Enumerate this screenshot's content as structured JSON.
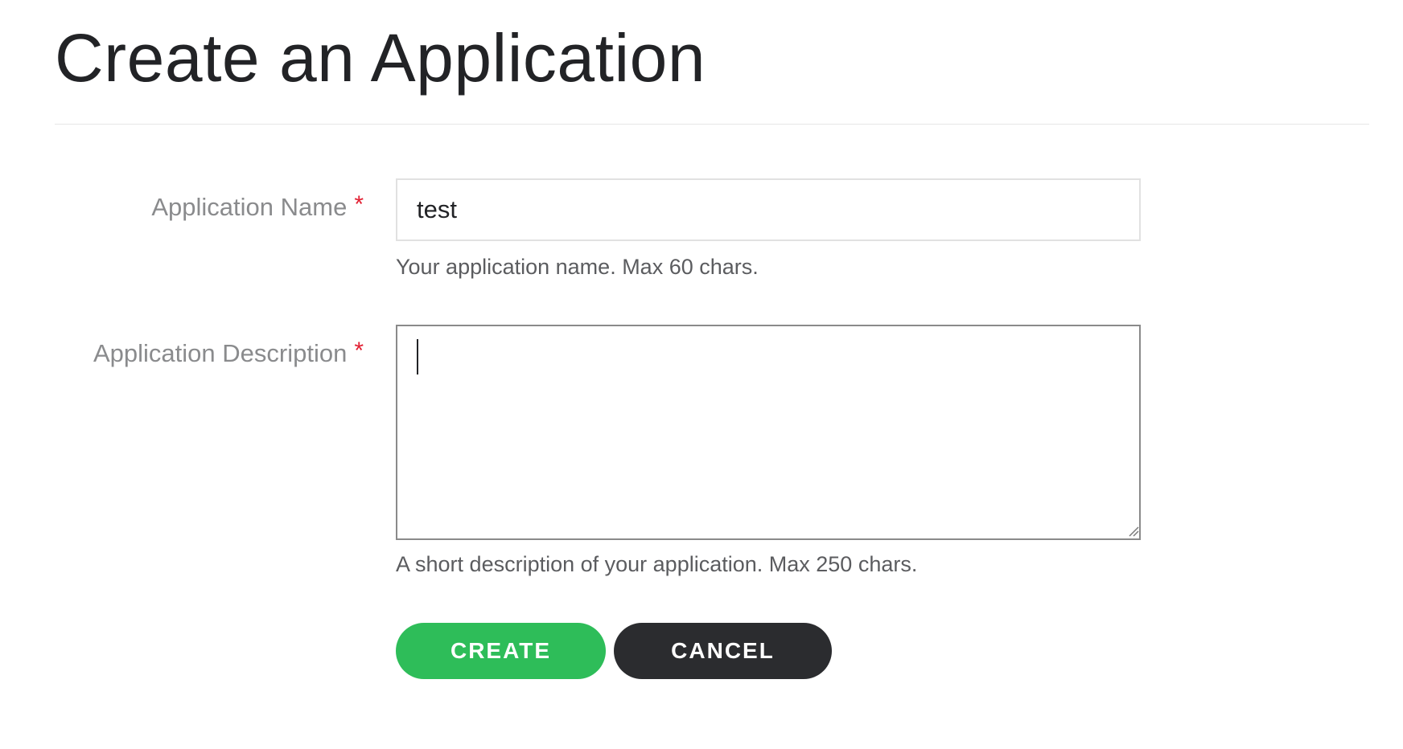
{
  "header": {
    "title": "Create an Application"
  },
  "form": {
    "name_field": {
      "label": "Application Name",
      "required_mark": "*",
      "value": "test",
      "help": "Your application name. Max 60 chars."
    },
    "description_field": {
      "label": "Application Description",
      "required_mark": "*",
      "value": "",
      "help": "A short description of your application. Max 250 chars."
    },
    "actions": {
      "create_label": "CREATE",
      "cancel_label": "CANCEL"
    }
  },
  "colors": {
    "primary": "#2ebd59",
    "secondary": "#2b2c2f",
    "required": "#e22134",
    "label": "#8a8b8d"
  },
  "icons": {
    "resize_handle": "resize-handle-icon"
  }
}
